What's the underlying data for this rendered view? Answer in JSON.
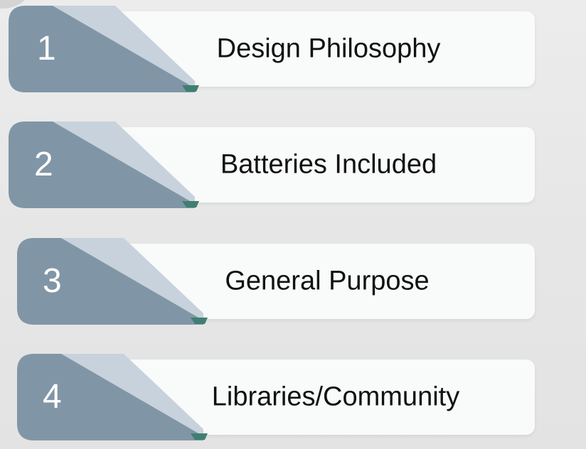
{
  "items": [
    {
      "number": "1",
      "label": "Design Philosophy"
    },
    {
      "number": "2",
      "label": "Batteries Included"
    },
    {
      "number": "3",
      "label": "General Purpose"
    },
    {
      "number": "4",
      "label": "Libraries/Community"
    }
  ],
  "colors": {
    "tab_dark": "#8096a6",
    "tab_light": "#c8d2dc",
    "accent": "#3f7f72",
    "card": "#f9fafa"
  }
}
